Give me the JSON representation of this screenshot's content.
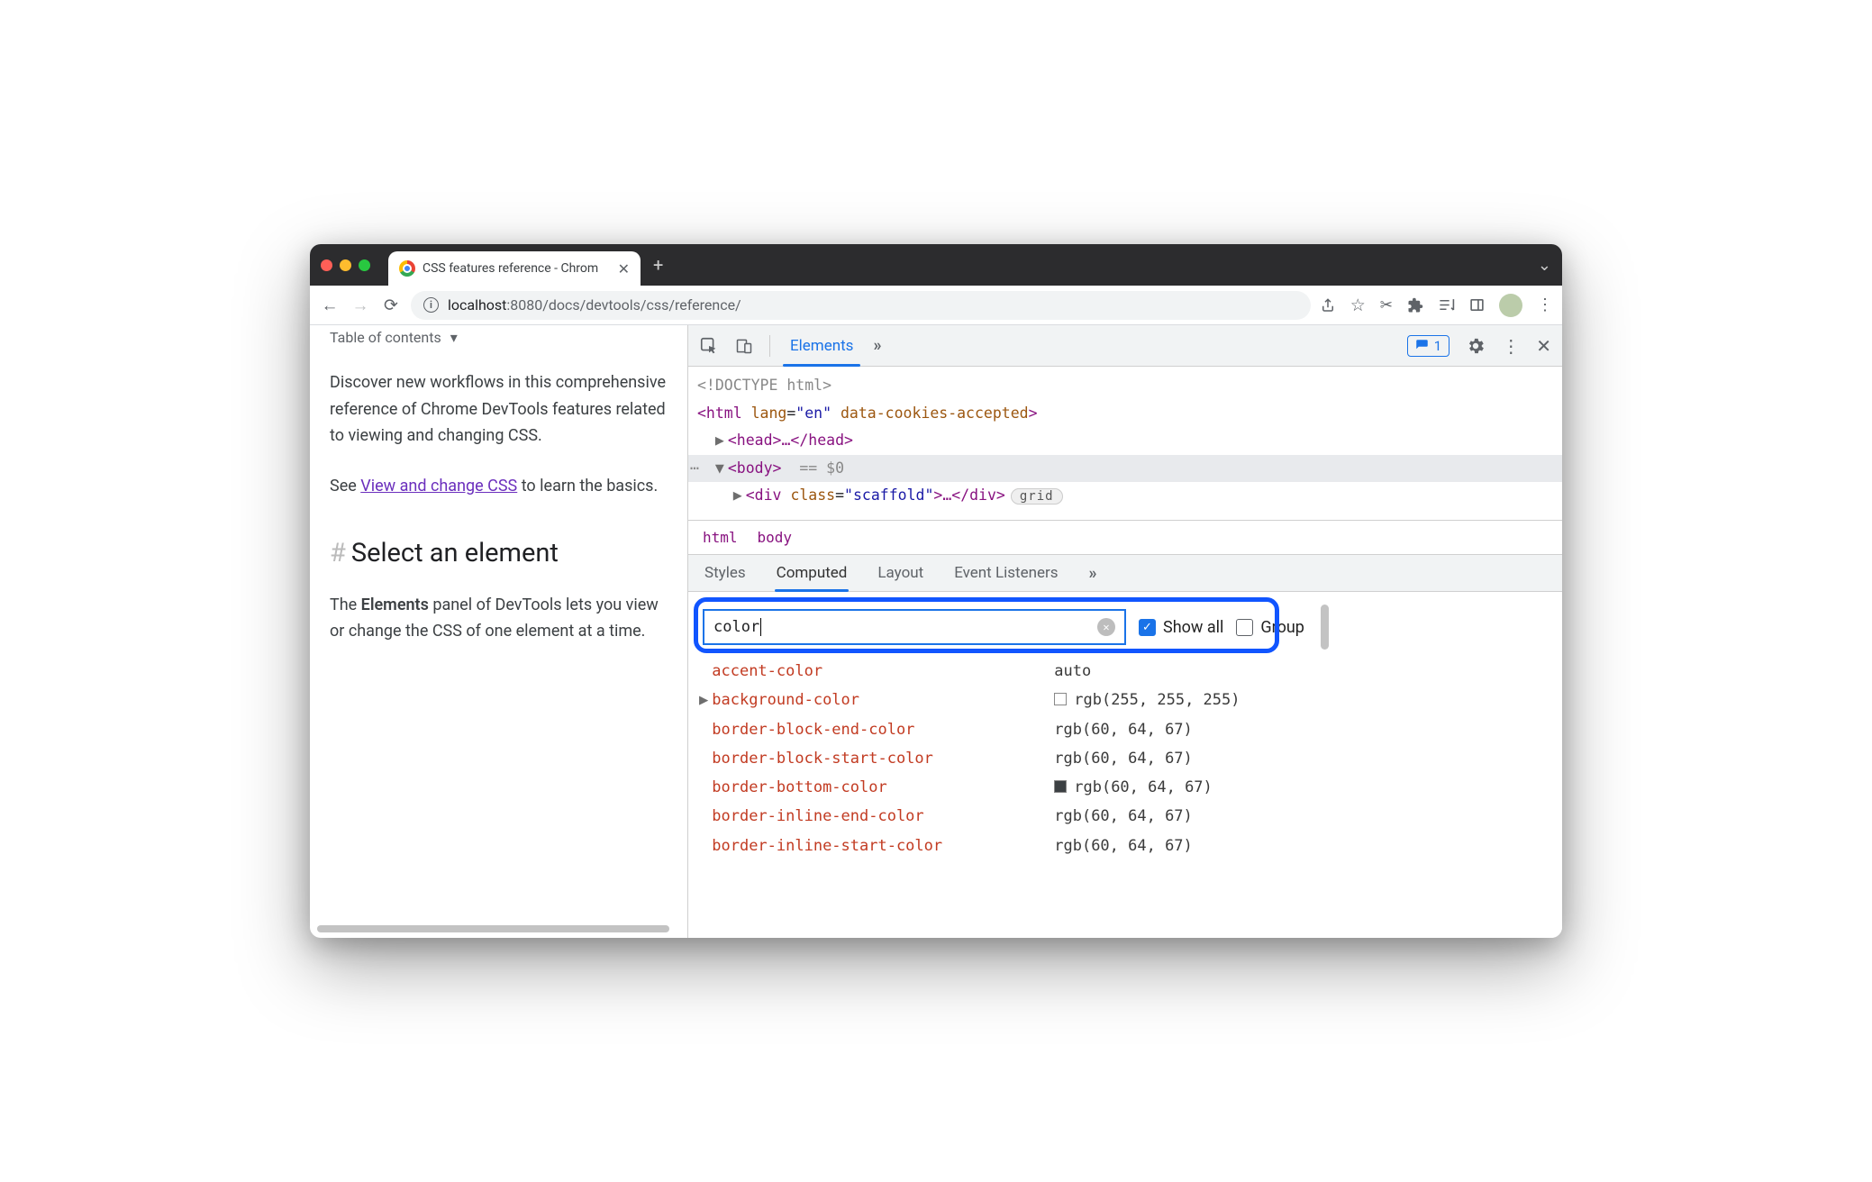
{
  "tab": {
    "title": "CSS features reference - Chrom"
  },
  "url": {
    "host": "localhost",
    "port": ":8080",
    "path": "/docs/devtools/css/reference/"
  },
  "page": {
    "toc": "Table of contents",
    "p1": "Discover new workflows in this comprehensive reference of Chrome DevTools features related to viewing and changing CSS.",
    "p2a": "See ",
    "p2link": "View and change CSS",
    "p2b": " to learn the basics.",
    "h2": "Select an element",
    "p3a": "The ",
    "p3b": "Elements",
    "p3c": " panel of DevTools lets you view or change the CSS of one element at a time."
  },
  "devtools": {
    "tabs": {
      "elements": "Elements"
    },
    "issues_count": "1",
    "dom": {
      "doctype": "<!DOCTYPE html>",
      "html_open": "<html",
      "lang_attr": "lang",
      "lang_val": "\"en\"",
      "cookies_attr": "data-cookies-accepted",
      "html_close": ">",
      "head": "<head>…</head>",
      "body": "<body>",
      "eq0": "== $0",
      "div_open": "<div",
      "class_attr": "class",
      "class_val": "\"scaffold\"",
      "div_mid": ">…</div>",
      "grid": "grid"
    },
    "crumbs": {
      "html": "html",
      "body": "body"
    },
    "subtabs": {
      "styles": "Styles",
      "computed": "Computed",
      "layout": "Layout",
      "events": "Event Listeners"
    },
    "filter": {
      "value": "color",
      "showall": "Show all",
      "group": "Group"
    },
    "computed": [
      {
        "prop": "accent-color",
        "val": "auto",
        "tri": false,
        "swatch": ""
      },
      {
        "prop": "background-color",
        "val": "rgb(255, 255, 255)",
        "tri": true,
        "swatch": "white"
      },
      {
        "prop": "border-block-end-color",
        "val": "rgb(60, 64, 67)",
        "tri": false,
        "swatch": ""
      },
      {
        "prop": "border-block-start-color",
        "val": "rgb(60, 64, 67)",
        "tri": false,
        "swatch": ""
      },
      {
        "prop": "border-bottom-color",
        "val": "rgb(60, 64, 67)",
        "tri": false,
        "swatch": "grey"
      },
      {
        "prop": "border-inline-end-color",
        "val": "rgb(60, 64, 67)",
        "tri": false,
        "swatch": ""
      },
      {
        "prop": "border-inline-start-color",
        "val": "rgb(60, 64, 67)",
        "tri": false,
        "swatch": ""
      }
    ]
  }
}
